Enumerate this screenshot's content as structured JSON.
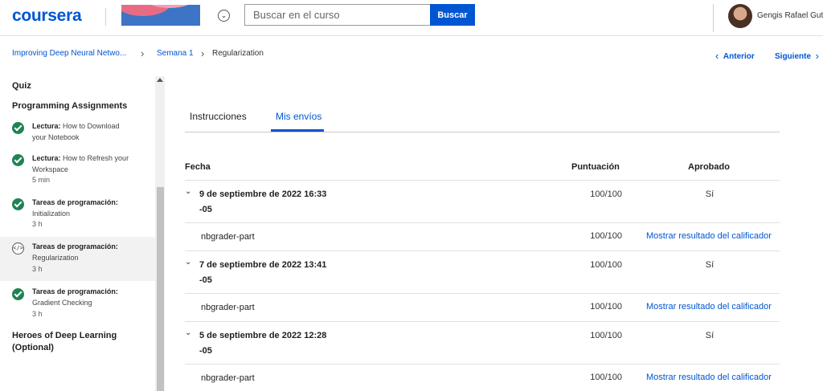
{
  "header": {
    "logo": "coursera",
    "search_placeholder": "Buscar en el curso",
    "search_button": "Buscar",
    "user_name": "Gengis Rafael Guti"
  },
  "breadcrumb": {
    "course": "Improving Deep Neural Netwo...",
    "week": "Semana 1",
    "current": "Regularization",
    "prev": "Anterior",
    "next": "Siguiente"
  },
  "sidebar": {
    "section_quiz": "Quiz",
    "section_programming": "Programming Assignments",
    "items": [
      {
        "kind": "Lectura:",
        "title": "How to Download",
        "title2": "your Notebook",
        "meta": "",
        "status": "check-icon"
      },
      {
        "kind": "Lectura:",
        "title": "How to Refresh your",
        "title2": "Workspace",
        "meta": "5 min",
        "status": "check-icon"
      },
      {
        "kind": "Tareas de programación:",
        "title": "Initialization",
        "title2": "",
        "meta": "3 h",
        "status": "check-icon"
      },
      {
        "kind": "Tareas de programación:",
        "title": "Regularization",
        "title2": "",
        "meta": "3 h",
        "status": "code-icon"
      },
      {
        "kind": "Tareas de programación:",
        "title": "Gradient Checking",
        "title2": "",
        "meta": "3 h",
        "status": "check-icon"
      }
    ],
    "section_heroes_1": "Heroes of Deep Learning",
    "section_heroes_2": "(Optional)"
  },
  "tabs": {
    "instructions": "Instrucciones",
    "submissions": "Mis envíos"
  },
  "table": {
    "col_date": "Fecha",
    "col_score": "Puntuación",
    "col_passed": "Aprobado",
    "rows": [
      {
        "date_1": "9 de septiembre de 2022 16:33",
        "date_2": "-05",
        "score": "100/100",
        "passed": "Sí",
        "part": "nbgrader-part",
        "part_score": "100/100",
        "link": "Mostrar resultado del calificador"
      },
      {
        "date_1": "7 de septiembre de 2022 13:41",
        "date_2": "-05",
        "score": "100/100",
        "passed": "Sí",
        "part": "nbgrader-part",
        "part_score": "100/100",
        "link": "Mostrar resultado del calificador"
      },
      {
        "date_1": "5 de septiembre de 2022 12:28",
        "date_2": "-05",
        "score": "100/100",
        "passed": "Sí",
        "part": "nbgrader-part",
        "part_score": "100/100",
        "link": "Mostrar resultado del calificador"
      }
    ]
  },
  "colors": {
    "brand_blue": "#0056d2",
    "success_green": "#1f8354"
  }
}
